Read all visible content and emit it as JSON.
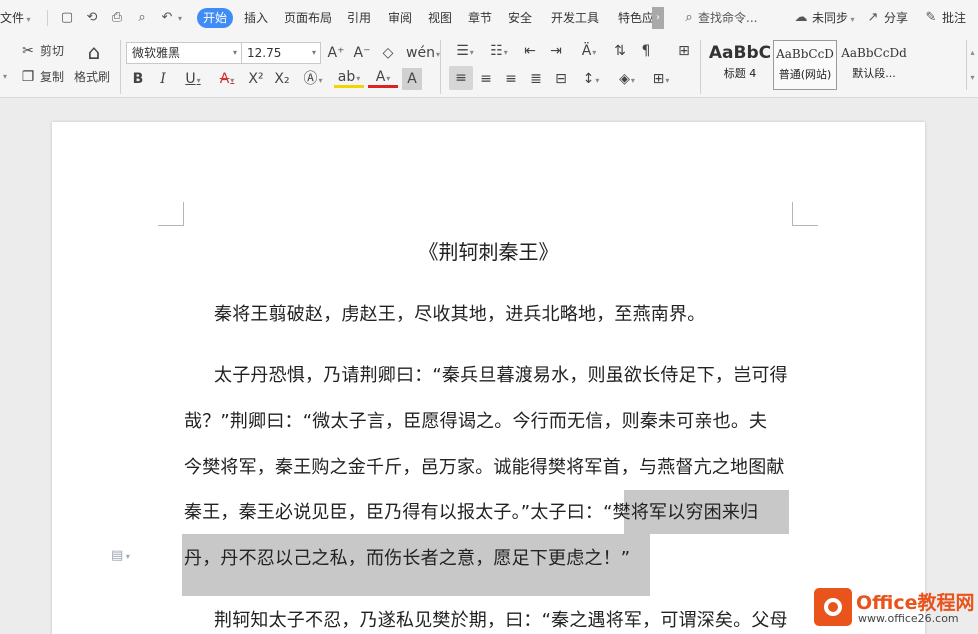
{
  "menu": {
    "file_label": "文件",
    "tabs": [
      "开始",
      "插入",
      "页面布局",
      "引用",
      "审阅",
      "视图",
      "章节",
      "安全",
      "开发工具",
      "特色应"
    ],
    "search_label": "查找命令...",
    "sync_label": "未同步",
    "share_label": "分享",
    "comment_label": "批注"
  },
  "ribbon": {
    "cut_label": "剪切",
    "copy_label": "复制",
    "format_painter_label": "格式刷",
    "font_name": "微软雅黑",
    "font_size": "12.75",
    "styles": [
      {
        "preview": "AaBbC",
        "name": "标题 4"
      },
      {
        "preview": "AaBbCcD",
        "name": "普通(网站)"
      },
      {
        "preview": "AaBbCcDd",
        "name": "默认段..."
      }
    ]
  },
  "document": {
    "title": "《荆轲刺秦王》",
    "lines": [
      "秦将王翦破赵，虏赵王，尽收其地，进兵北略地，至燕南界。",
      "太子丹恐惧，乃请荆卿曰：“秦兵旦暮渡易水，则虽欲长侍足下，岂可得",
      "哉？”荆卿曰：“微太子言，臣愿得谒之。今行而无信，则秦未可亲也。夫",
      "今樊将军，秦王购之金千斤，邑万家。诚能得樊将军首，与燕督亢之地图献",
      "秦王，秦王必说见臣，臣乃得有以报太子。”太子曰：",
      "“樊将军以穷困来归",
      "丹，丹不忍以己之私，而伤长者之意，愿足下更虑之！”",
      "荆轲知太子不忍，乃遂私见樊於期，曰：“秦之遇将军，可谓深矣。父母"
    ]
  },
  "watermark": {
    "brand": "Office教程网",
    "url": "www.office26.com"
  },
  "colors": {
    "accent": "#3f8cf6",
    "selection": "#c8c8c8",
    "logo": "#e9531c"
  }
}
